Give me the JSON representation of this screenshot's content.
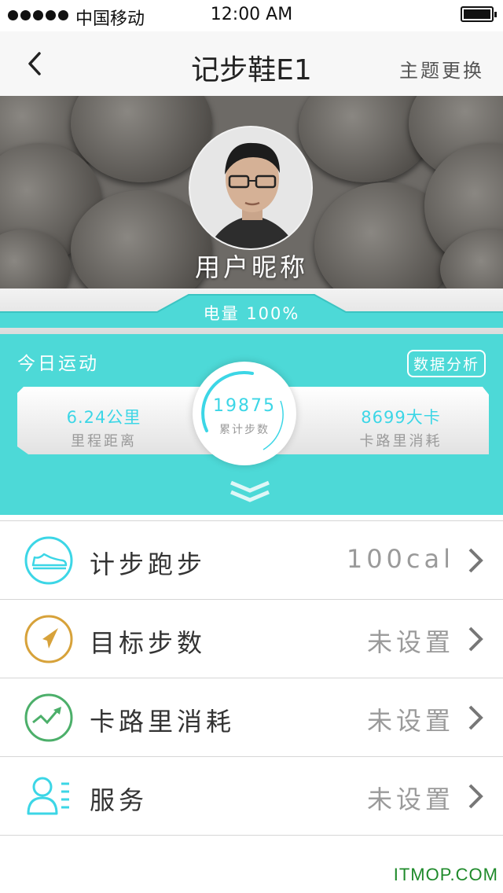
{
  "status_bar": {
    "carrier": "中国移动",
    "time": "12:00 AM"
  },
  "nav": {
    "title": "记步鞋E1",
    "theme_label": "主题更换"
  },
  "profile": {
    "nickname": "用户昵称"
  },
  "battery": {
    "text": "电量 100%"
  },
  "today": {
    "label": "今日运动",
    "analysis_label": "数据分析",
    "distance_value": "6.24公里",
    "distance_label": "里程距离",
    "steps_value": "19875",
    "steps_label": "累计步数",
    "calories_value": "8699大卡",
    "calories_label": "卡路里消耗"
  },
  "menu": {
    "items": [
      {
        "label": "计步跑步",
        "value": "100cal",
        "icon": "sneaker-icon"
      },
      {
        "label": "目标步数",
        "value": "未设置",
        "icon": "navigation-arrow-icon"
      },
      {
        "label": "卡路里消耗",
        "value": "未设置",
        "icon": "trend-chart-icon"
      },
      {
        "label": "服务",
        "value": "未设置",
        "icon": "user-list-icon"
      }
    ]
  },
  "colors": {
    "accent": "#4dd9d7",
    "highlight": "#3cd6e6",
    "icon_orange": "#d7a23a",
    "icon_green": "#4caf6a"
  },
  "watermark": "ITMOP.COM"
}
